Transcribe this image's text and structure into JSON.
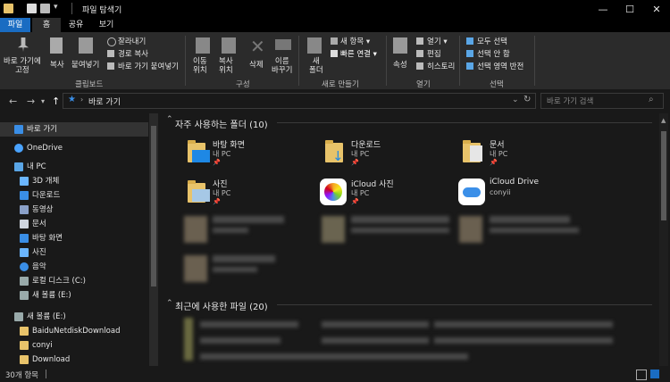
{
  "window": {
    "title": "파일 탐색기",
    "minimize": "—",
    "maximize": "☐",
    "close": "✕"
  },
  "ribbon_tabs": [
    "파일",
    "홈",
    "공유",
    "보기"
  ],
  "ribbon": {
    "pin_to_quick": "바로 가기에\n고정",
    "copy": "복사",
    "paste": "붙여넣기",
    "cut": "잘라내기",
    "copy_path": "경로 복사",
    "paste_shortcut": "바로 가기 붙여넣기",
    "group_clipboard": "클립보드",
    "move_to": "이동\n위치",
    "copy_to": "복사\n위치",
    "delete": "삭제",
    "rename": "이름\n바꾸기",
    "group_organize": "구성",
    "new_folder": "새\n폴더",
    "new_item": "새 항목 ▾",
    "easy_access": "빠른 연결 ▾",
    "group_new": "새로 만들기",
    "properties": "속성",
    "open": "열기 ▾",
    "edit": "편집",
    "history": "히스토리",
    "group_open": "열기",
    "select_all": "모두 선택",
    "select_none": "선택 안 함",
    "invert_selection": "선택 영역 반전",
    "group_select": "선택"
  },
  "nav": {
    "breadcrumb": "바로 가기",
    "search_placeholder": "바로 가기 검색"
  },
  "sidebar": {
    "items": [
      {
        "label": "바로 가기",
        "color": "#3a8ee6"
      },
      {
        "label": "OneDrive",
        "color": "#4aa3ff"
      },
      {
        "label": "내 PC",
        "color": "#5aa6e6"
      },
      {
        "label": "3D 개체",
        "color": "#6bb6ff"
      },
      {
        "label": "다운로드",
        "color": "#3a8ee6"
      },
      {
        "label": "동영상",
        "color": "#8aa0c8"
      },
      {
        "label": "문서",
        "color": "#cfd6e0"
      },
      {
        "label": "바탕 화면",
        "color": "#3a8ee6"
      },
      {
        "label": "사진",
        "color": "#6bb6ff"
      },
      {
        "label": "음악",
        "color": "#3a8ee6"
      },
      {
        "label": "로컬 디스크 (C:)",
        "color": "#9aa"
      },
      {
        "label": "새 볼륨 (E:)",
        "color": "#9aa"
      },
      {
        "label": "새 볼륨 (E:)",
        "color": "#9aa"
      },
      {
        "label": "BaiduNetdiskDownload",
        "color": "#e8c36a"
      },
      {
        "label": "conyi",
        "color": "#e8c36a"
      },
      {
        "label": "Download",
        "color": "#e8c36a"
      }
    ]
  },
  "main": {
    "frequent_header": "자주 사용하는 폴더 (10)",
    "recent_header": "최근에 사용한 파일 (20)",
    "tiles": [
      {
        "name": "바탕 화면",
        "sub": "내 PC"
      },
      {
        "name": "다운로드",
        "sub": "내 PC"
      },
      {
        "name": "문서",
        "sub": "내 PC"
      },
      {
        "name": "사진",
        "sub": "내 PC"
      },
      {
        "name": "iCloud 사진",
        "sub": "내 PC"
      },
      {
        "name": "iCloud Drive",
        "sub": "conyii"
      }
    ]
  },
  "status": {
    "count": "30개 항목"
  }
}
